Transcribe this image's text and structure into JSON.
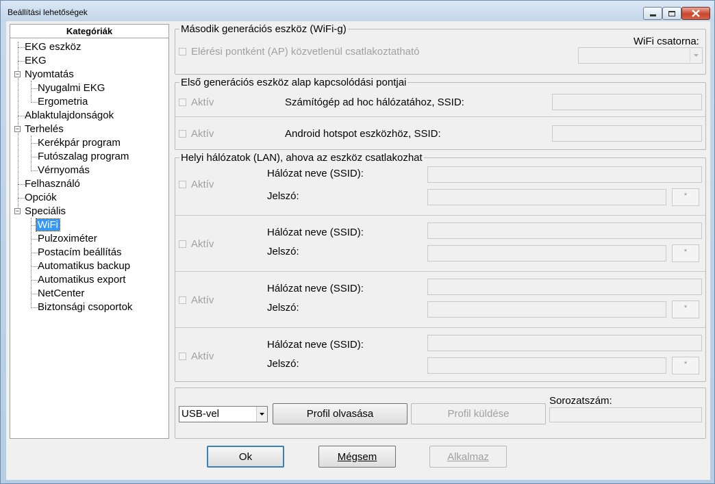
{
  "window": {
    "title": "Beállítási lehetőségek"
  },
  "tree": {
    "header": "Kategóriák",
    "items": [
      {
        "label": "EKG eszköz"
      },
      {
        "label": "EKG"
      },
      {
        "label": "Nyomtatás"
      },
      {
        "label": "Nyugalmi EKG"
      },
      {
        "label": "Ergometria"
      },
      {
        "label": "Ablaktulajdonságok"
      },
      {
        "label": "Terhelés"
      },
      {
        "label": "Kerékpár program"
      },
      {
        "label": "Futószalag program"
      },
      {
        "label": "Vérnyomás"
      },
      {
        "label": "Felhasználó"
      },
      {
        "label": "Opciók"
      },
      {
        "label": "Speciális"
      },
      {
        "label": "WiFi"
      },
      {
        "label": "Pulzoximéter"
      },
      {
        "label": "Postacím beállítás"
      },
      {
        "label": "Automatikus backup"
      },
      {
        "label": "Automatikus export"
      },
      {
        "label": "NetCenter"
      },
      {
        "label": "Biztonsági csoportok"
      }
    ],
    "selected": "WiFi"
  },
  "second_gen": {
    "title": "Második generációs eszköz (WiFi-g)",
    "ap_checkbox": "Elérési pontként (AP) közvetlenül csatlakoztatható",
    "channel_label": "WiFi csatorna:"
  },
  "first_gen": {
    "title": "Első generációs eszköz alap kapcsolódási pontjai",
    "rows": [
      {
        "checkbox": "Aktív",
        "label": "Számítógép ad hoc hálózatához, SSID:"
      },
      {
        "checkbox": "Aktív",
        "label": "Android hotspot eszközhöz, SSID:"
      }
    ]
  },
  "lan": {
    "title": "Helyi hálózatok (LAN), ahova az eszköz csatlakozhat",
    "rows": [
      {
        "checkbox": "Aktív",
        "ssid_label": "Hálózat neve (SSID):",
        "password_label": "Jelszó:",
        "star": "*"
      },
      {
        "checkbox": "Aktív",
        "ssid_label": "Hálózat neve (SSID):",
        "password_label": "Jelszó:",
        "star": "*"
      },
      {
        "checkbox": "Aktív",
        "ssid_label": "Hálózat neve (SSID):",
        "password_label": "Jelszó:",
        "star": "*"
      },
      {
        "checkbox": "Aktív",
        "ssid_label": "Hálózat neve (SSID):",
        "password_label": "Jelszó:",
        "star": "*"
      }
    ]
  },
  "bottom": {
    "connection_select": "USB-vel",
    "read_profile": "Profil olvasása",
    "send_profile": "Profil küldése",
    "serial_label": "Sorozatszám:"
  },
  "footer": {
    "ok": "Ok",
    "cancel": "Mégsem",
    "apply": "Alkalmaz"
  }
}
